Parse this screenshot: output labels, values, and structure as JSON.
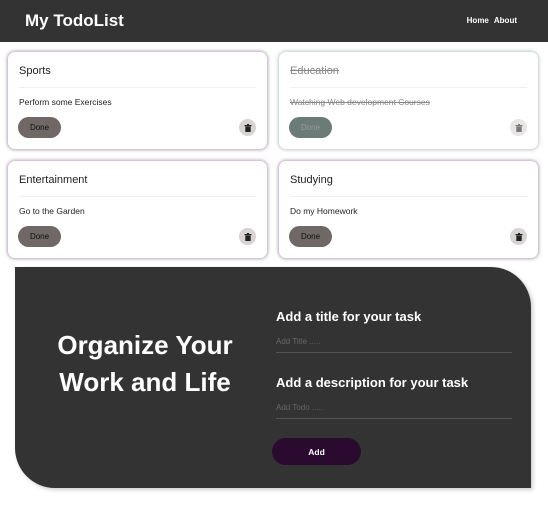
{
  "header": {
    "title": "My TodoList",
    "nav": [
      "Home",
      "About"
    ]
  },
  "todos": [
    {
      "title": "Sports",
      "desc": "Perform some Exercises",
      "done": false,
      "button": "Done"
    },
    {
      "title": "Education",
      "desc": "Watching Web development Courses",
      "done": true,
      "button": "Done"
    },
    {
      "title": "Entertainment",
      "desc": "Go to the Garden",
      "done": false,
      "button": "Done"
    },
    {
      "title": "Studying",
      "desc": "Do my Homework",
      "done": false,
      "button": "Done"
    }
  ],
  "form": {
    "slogan_line1": "Organize Your",
    "slogan_line2": "Work and Life",
    "title_label": "Add a title for your task",
    "title_placeholder": "Add Title .....",
    "desc_label": "Add a description for your task",
    "desc_placeholder": "Add Todo .....",
    "add_label": "Add"
  }
}
